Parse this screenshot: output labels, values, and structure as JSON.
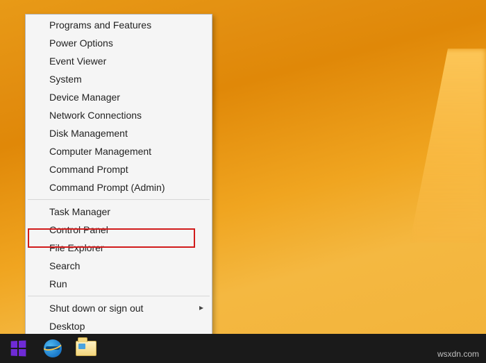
{
  "menu": {
    "group1": [
      "Programs and Features",
      "Power Options",
      "Event Viewer",
      "System",
      "Device Manager",
      "Network Connections",
      "Disk Management",
      "Computer Management",
      "Command Prompt",
      "Command Prompt (Admin)"
    ],
    "group2": [
      "Task Manager",
      "Control Panel",
      "File Explorer",
      "Search",
      "Run"
    ],
    "group3": [
      "Shut down or sign out",
      "Desktop"
    ]
  },
  "highlight_target": "Control Panel",
  "watermark": "wsxdn.com"
}
